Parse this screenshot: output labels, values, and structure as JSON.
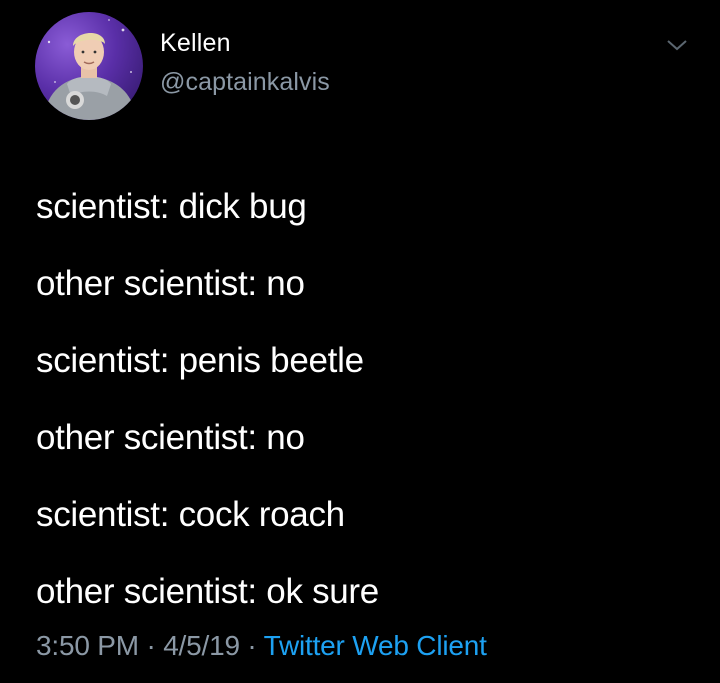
{
  "tweet": {
    "author": {
      "display_name": "Kellen",
      "handle": "@captainkalvis"
    },
    "lines": [
      "scientist: dick bug",
      "other scientist: no",
      "scientist: penis beetle",
      "other scientist: no",
      "scientist: cock roach",
      "other scientist: ok sure"
    ],
    "time": "3:50 PM",
    "separator": " · ",
    "date": "4/5/19",
    "source": "Twitter Web Client"
  },
  "colors": {
    "background": "#000000",
    "text": "#ffffff",
    "muted": "#8b98a5",
    "link": "#1da1f2"
  },
  "icons": {
    "menu": "chevron-down-icon"
  }
}
